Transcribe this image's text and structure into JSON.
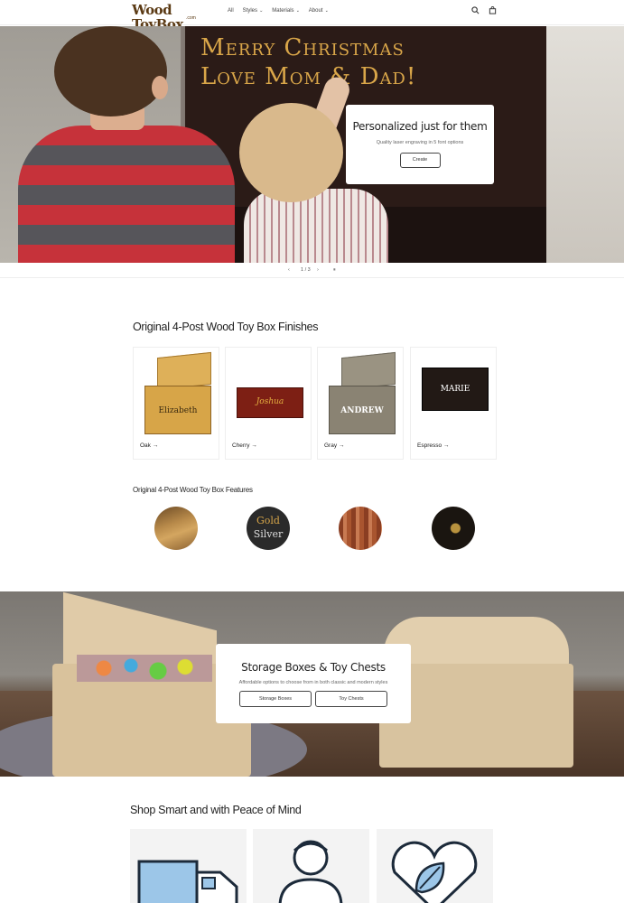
{
  "brand": {
    "logo_text": "Wood ToyBox",
    "logo_suffix": ".com"
  },
  "nav": {
    "items": [
      {
        "label": "All"
      },
      {
        "label": "Styles"
      },
      {
        "label": "Materials"
      },
      {
        "label": "About"
      }
    ]
  },
  "hero": {
    "engraving": "Merry Christmas\nLove Mom & Dad!",
    "title": "Personalized just for them",
    "subtitle": "Quality laser engraving in 5 font options",
    "cta": "Create"
  },
  "slider": {
    "counter": "1 / 3",
    "prev": "‹",
    "next": "›",
    "pause": "⏸"
  },
  "finishes": {
    "title": "Original 4-Post Wood Toy Box Finishes",
    "items": [
      {
        "label": "Oak →",
        "box_name": "Elizabeth",
        "body_color": "#d7a548",
        "lid_color": "#deb059",
        "text_color": "#3a2a10"
      },
      {
        "label": "Cherry →",
        "box_name": "Joshua",
        "body_color": "#7d1f14",
        "lid_color": "#8a2a1a",
        "text_color": "#e3b040"
      },
      {
        "label": "Gray →",
        "box_name": "ANDREW",
        "body_color": "#8a8373",
        "lid_color": "#9a9382",
        "text_color": "#ffffff"
      },
      {
        "label": "Espresso →",
        "box_name": "MARIE",
        "body_color": "#221915",
        "lid_color": "#2b201a",
        "text_color": "#ffffff"
      }
    ]
  },
  "features": {
    "title": "Original 4-Post Wood Toy Box Features",
    "circles": [
      {
        "name": "wood-corner",
        "color": "#b88a4a"
      },
      {
        "name": "gold-silver",
        "gold": "Gold",
        "silver": "Silver"
      },
      {
        "name": "cedar-wood",
        "color": "#b4603a"
      },
      {
        "name": "hinge",
        "color": "#1a1510"
      }
    ]
  },
  "storage": {
    "title": "Storage Boxes & Toy Chests",
    "subtitle": "Affordable options to choose from in both classic and modern styles",
    "buttons": [
      {
        "label": "Storage Boxes"
      },
      {
        "label": "Toy Chests"
      }
    ]
  },
  "shop": {
    "title": "Shop Smart and with Peace of Mind"
  }
}
